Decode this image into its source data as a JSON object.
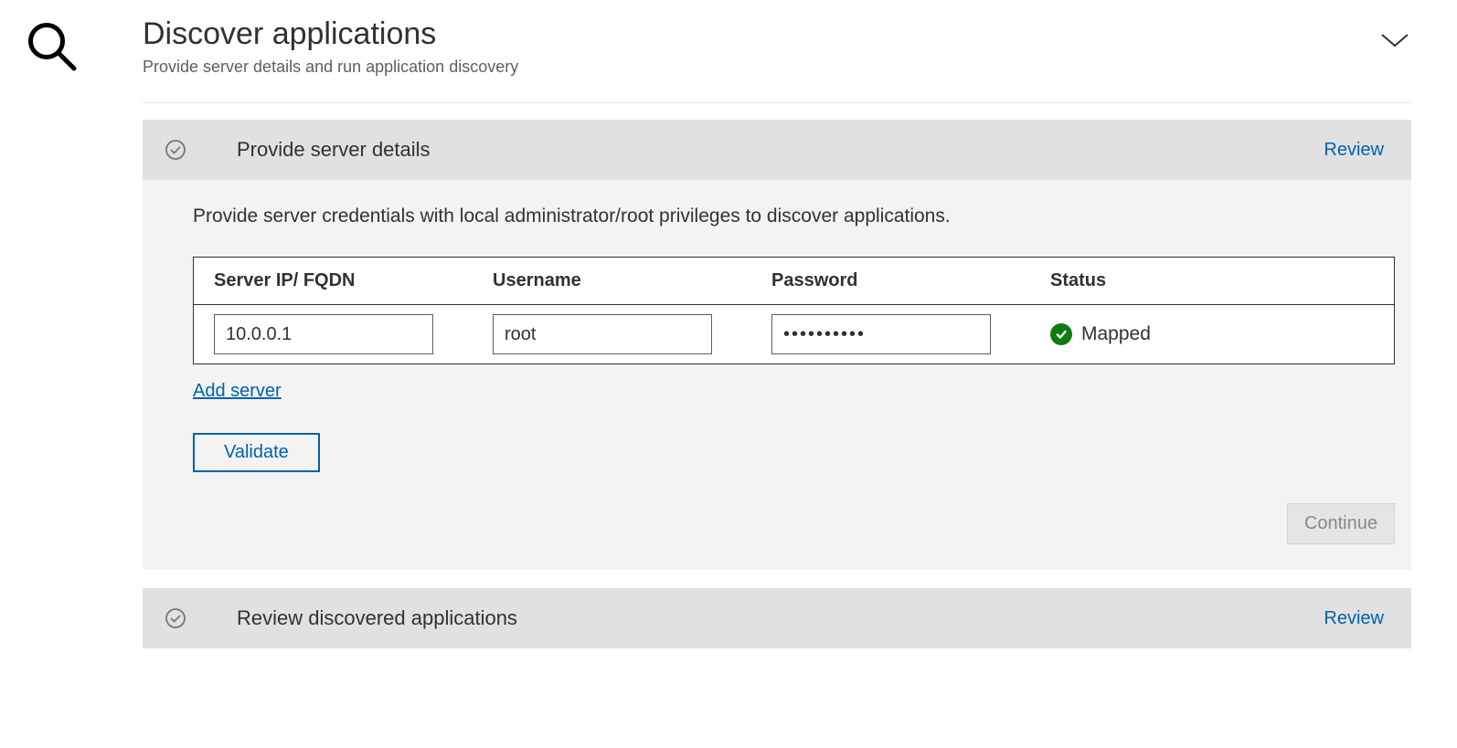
{
  "header": {
    "title": "Discover applications",
    "subtitle": "Provide server details and run application discovery"
  },
  "step1": {
    "title": "Provide server details",
    "review_label": "Review",
    "instruction": "Provide server credentials with local administrator/root privileges to discover applications.",
    "columns": {
      "ip": "Server IP/ FQDN",
      "user": "Username",
      "pass": "Password",
      "status": "Status"
    },
    "rows": [
      {
        "ip": "10.0.0.1",
        "user": "root",
        "pass": "••••••••••",
        "status": "Mapped"
      }
    ],
    "add_server_label": "Add server",
    "validate_label": "Validate",
    "continue_label": "Continue"
  },
  "step2": {
    "title": "Review discovered applications",
    "review_label": "Review"
  }
}
